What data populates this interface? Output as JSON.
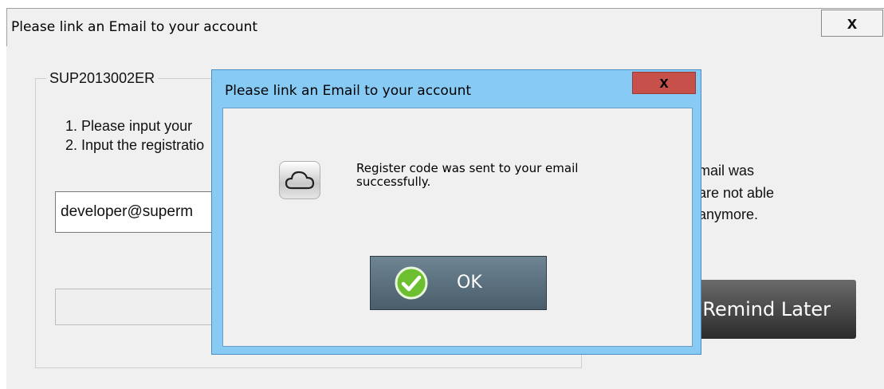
{
  "parent_window": {
    "title": "Please link an Email to your account",
    "close_glyph": "x",
    "group_label": "SUP2013002ER",
    "instructions": [
      "1. Please input your",
      "2. Input the registratio"
    ],
    "email_value": "developer@superm",
    "note_lines": [
      "mail was",
      "are not able",
      "anymore."
    ],
    "remind_later_label": "Remind Later"
  },
  "dialog": {
    "title": "Please link an Email to your account",
    "close_glyph": "x",
    "icon": "icloud-icon",
    "message": "Register code was sent to your email successfully.",
    "ok_label": "OK",
    "ok_icon": "check-icon"
  },
  "colors": {
    "dialog_frame": "#87cbf5",
    "dialog_close": "#c7504a",
    "ok_button": "#5d7380",
    "remind_button": "#3a3a3a"
  }
}
